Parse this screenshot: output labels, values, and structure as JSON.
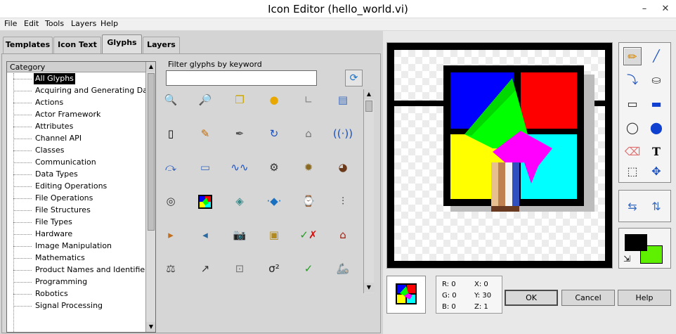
{
  "window": {
    "title": "Icon Editor (hello_world.vi)"
  },
  "menu": [
    "File",
    "Edit",
    "Tools",
    "Layers",
    "Help"
  ],
  "tabs": [
    {
      "label": "Templates",
      "active": false
    },
    {
      "label": "Icon Text",
      "active": false
    },
    {
      "label": "Glyphs",
      "active": true
    },
    {
      "label": "Layers",
      "active": false
    }
  ],
  "category": {
    "header": "Category",
    "items": [
      "All Glyphs",
      "Acquiring and Generating Data",
      "Actions",
      "Actor Framework",
      "Attributes",
      "Channel API",
      "Classes",
      "Communication",
      "Data Types",
      "Editing Operations",
      "File Operations",
      "File Structures",
      "File Types",
      "Hardware",
      "Image Manipulation",
      "Mathematics",
      "Product Names and Identifiers",
      "Programming",
      "Robotics",
      "Signal Processing"
    ],
    "selected": "All Glyphs"
  },
  "filter": {
    "label": "Filter glyphs by keyword",
    "value": "",
    "refresh_icon": "refresh-icon"
  },
  "glyphs": [
    [
      "zoom-in-glyph",
      "zoom-out-glyph",
      "copy-glyph",
      "coin-glyph",
      "graph-axis-glyph",
      "device-glyph"
    ],
    [
      "remote-glyph",
      "pencil-glyph",
      "pen-glyph",
      "refresh-glyph",
      "cpu-glyph",
      "wireless-glyph"
    ],
    [
      "probe-glyph",
      "window-glyph",
      "waveform-glyph",
      "gear-glyph",
      "dog-glyph",
      "reel-glyph"
    ],
    [
      "ring-glyph",
      "color-square-glyph",
      "3d-surface-glyph",
      "dots-glyph",
      "watch-glyph",
      "cable-glyph"
    ],
    [
      "play-color-glyph",
      "arrow-left-glyph",
      "camera-glyph",
      "board-glyph",
      "check-x-glyph",
      "factory-glyph"
    ],
    [
      "scale-glyph",
      "vector-glyph",
      "sensor-glyph",
      "sigma-squared-glyph",
      "check-glyph",
      "robot-arm-glyph"
    ]
  ],
  "glyph_texts": {
    "sigma": "σ²"
  },
  "tools": [
    "pencil-icon",
    "line-icon",
    "dropper-icon",
    "fill-icon",
    "rectangle-icon",
    "filled-rectangle-icon",
    "ellipse-icon",
    "filled-ellipse-icon",
    "eraser-icon",
    "text-icon",
    "select-icon",
    "move-icon"
  ],
  "selected_tool": "pencil-icon",
  "colors": {
    "foreground": "#000000",
    "background": "#5ef000"
  },
  "info": {
    "r": "R: 0",
    "g": "G: 0",
    "b": "B: 0",
    "x": "X: 0",
    "y": "Y: 30",
    "z": "Z: 1"
  },
  "buttons": {
    "ok": "OK",
    "cancel": "Cancel",
    "help": "Help"
  }
}
